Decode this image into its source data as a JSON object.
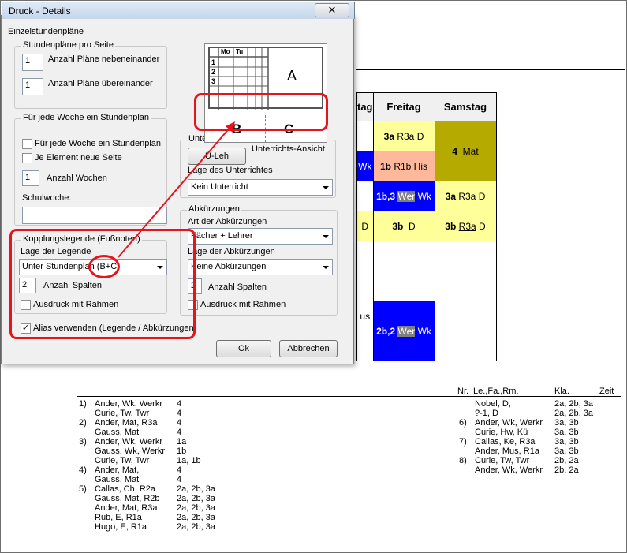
{
  "timetable": {
    "headers": [
      "tag",
      "Freitag",
      "Samstag"
    ],
    "cells": {
      "r1_fri": [
        "3a",
        "R3a D"
      ],
      "r1_sat": [
        "4",
        "Mat"
      ],
      "r2_col0": "Wk",
      "r2_fri": [
        "1b",
        "R1b His"
      ],
      "r3_fri": [
        "1b,3",
        "Wer",
        "Wk"
      ],
      "r3_sat": [
        "3a",
        "R3a D"
      ],
      "r4_col0": "D",
      "r4_fri": [
        "3b",
        "D"
      ],
      "r4_sat": [
        "3b",
        "R3a",
        "D"
      ],
      "r7_col0": "us",
      "r7_fri": [
        "2b,2",
        "Wer",
        "Wk"
      ]
    }
  },
  "legend_header": {
    "nr": "Nr.",
    "lefarm": "Le.,Fa.,Rm.",
    "kla": "Kla.",
    "zeit": "Zeit"
  },
  "legend_left": [
    {
      "nr": "1)",
      "name": "Ander, Wk, Werkr",
      "val": "4"
    },
    {
      "nr": "",
      "name": "Curie, Tw, Twr",
      "val": "4"
    },
    {
      "nr": "2)",
      "name": "Ander, Mat, R3a",
      "val": "4"
    },
    {
      "nr": "",
      "name": "Gauss, Mat",
      "val": "4"
    },
    {
      "nr": "3)",
      "name": "Ander, Wk, Werkr",
      "val": "1a"
    },
    {
      "nr": "",
      "name": "Gauss, Wk, Werkr",
      "val": "1b"
    },
    {
      "nr": "",
      "name": "Curie, Tw, Twr",
      "val": "1a, 1b"
    },
    {
      "nr": "4)",
      "name": "Ander, Mat,",
      "val": "4"
    },
    {
      "nr": "",
      "name": "Gauss, Mat",
      "val": "4"
    },
    {
      "nr": "5)",
      "name": "Callas, Ch, R2a",
      "val": "2a, 2b, 3a"
    },
    {
      "nr": "",
      "name": "Gauss, Mat, R2b",
      "val": "2a, 2b, 3a"
    },
    {
      "nr": "",
      "name": "Ander, Mat, R3a",
      "val": "2a, 2b, 3a"
    },
    {
      "nr": "",
      "name": "Rub, E, R1a",
      "val": "2a, 2b, 3a"
    },
    {
      "nr": "",
      "name": "Hugo, E, R1a",
      "val": "2a, 2b, 3a"
    }
  ],
  "legend_right": [
    {
      "nr": "",
      "name": "Nobel, D,",
      "val": "2a, 2b, 3a"
    },
    {
      "nr": "",
      "name": "?-1, D",
      "val": "2a, 2b, 3a"
    },
    {
      "nr": "6)",
      "name": "Ander, Wk, Werkr",
      "val": "3a, 3b"
    },
    {
      "nr": "",
      "name": "Curie, Hw, Kü",
      "val": "3a, 3b"
    },
    {
      "nr": "7)",
      "name": "Callas, Ke, R3a",
      "val": "3a, 3b"
    },
    {
      "nr": "",
      "name": "Ander, Mus, R1a",
      "val": "3a, 3b"
    },
    {
      "nr": "8)",
      "name": "Curie, Tw, Twr",
      "val": "2b, 2a"
    },
    {
      "nr": "",
      "name": "Ander, Wk, Werkr",
      "val": "2b, 2a"
    }
  ],
  "dialog": {
    "title": "Druck - Details",
    "close": "✕",
    "section_title": "Einzelstundenpläne",
    "per_page": {
      "title": "Stundenpläne pro Seite",
      "side_value": "1",
      "side_label": "Anzahl Pläne nebeneinander",
      "stack_value": "1",
      "stack_label": "Anzahl Pläne übereinander"
    },
    "weekly": {
      "title": "Für jede Woche ein Stundenplan",
      "chk_week": "Für jede Woche ein Stundenplan",
      "chk_element": "Je Element neue Seite",
      "weeks_value": "1",
      "weeks_label": "Anzahl Wochen",
      "schoolweek_label": "Schulwoche:",
      "schoolweek_value": ""
    },
    "coupling": {
      "title": "Kopplungslegende (Fußnoten)",
      "position_label": "Lage der Legende",
      "position_value": "Unter Stundenplan (B+C)",
      "cols_value": "2",
      "cols_label": "Anzahl Spalten",
      "frame_label": "Ausdruck mit Rahmen"
    },
    "alias_label": "Alias verwenden (Legende / Abkürzungen)",
    "alias_checked": "✓",
    "lesson": {
      "title": "Unterricht:",
      "button": "U-Leh",
      "view_label": "Unterrichts-Ansicht",
      "position_label": "Lage des Unterrichtes",
      "position_value": "Kein Unterricht"
    },
    "abbrev": {
      "title": "Abkürzungen",
      "kind_label": "Art der Abkürzungen",
      "kind_value": "Fächer + Lehrer",
      "position_label": "Lage der Abkürzungen",
      "position_value": "Keine Abkürzungen",
      "cols_value": "2",
      "cols_label": "Anzahl Spalten",
      "frame_label": "Ausdruck mit Rahmen"
    },
    "preview": {
      "col1": "Mo",
      "col2": "Tu",
      "rows": [
        "1",
        "2",
        "3"
      ],
      "area_a": "A",
      "area_b": "B",
      "area_c": "C"
    },
    "ok": "Ok",
    "cancel": "Abbrechen"
  }
}
